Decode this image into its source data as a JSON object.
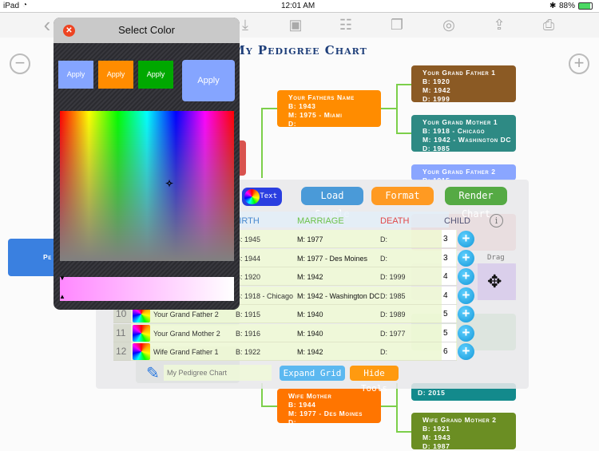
{
  "status": {
    "device": "iPad",
    "time": "12:01 AM",
    "battery": "88%"
  },
  "toolbar": {
    "icons": [
      "back-chevron-icon",
      "download-icon",
      "save-floppy-icon",
      "cabinet-icon",
      "windows-icon",
      "camera-icon",
      "share-icon",
      "printer-icon"
    ]
  },
  "chart": {
    "title": "My Pedigree Chart",
    "boxes": [
      {
        "lines": [
          "Your Grand Father  1",
          "B: 1920",
          "M: 1942",
          "D: 1999"
        ],
        "color": "#8b5a24"
      },
      {
        "lines": [
          "Your Fathers Name",
          "B: 1943",
          "M: 1975 - Miami",
          "D:"
        ],
        "color": "#ff8c00"
      },
      {
        "lines": [
          "Your Grand Mother 1",
          "B: 1918 - Chicago",
          "M: 1942 - Washington DC",
          "D: 1985"
        ],
        "color": "#2e8a84"
      },
      {
        "lines": [
          "Your Grand Father 2",
          "B: 1915"
        ],
        "color": "#8aa6ff"
      },
      {
        "lines": [
          "Pe"
        ],
        "color": "#3a80e0"
      },
      {
        "lines": [
          "D: 2015"
        ],
        "color": "#138a8c"
      },
      {
        "lines": [
          "Wife Mother",
          "B: 1944",
          "M: 1977 - Des Moines",
          "D:"
        ],
        "color": "#ff7500"
      },
      {
        "lines": [
          "Wife Grand Mother 2",
          "B: 1921",
          "M: 1943",
          "D: 1987"
        ],
        "color": "#6b8e23"
      }
    ]
  },
  "tools": {
    "text_button": "Text",
    "load_sample": "Load Sample",
    "format": "Format",
    "render_chart": "Render Chart",
    "headers": {
      "birth": "BIRTH",
      "marriage": "MARRIAGE",
      "death": "DEATH",
      "child": "CHILD"
    },
    "rows": [
      {
        "num": "",
        "name": "",
        "birth": "B: 1945",
        "marriage": "M: 1977",
        "death": "D:",
        "child": "3"
      },
      {
        "num": "",
        "name": "",
        "birth": "B: 1944",
        "marriage": "M: 1977 - Des Moines",
        "death": "D:",
        "child": "3"
      },
      {
        "num": "",
        "name": "",
        "birth": "B: 1920",
        "marriage": "M: 1942",
        "death": "D: 1999",
        "child": "4"
      },
      {
        "num": "",
        "name": "",
        "birth": "B: 1918 - Chicago",
        "marriage": "M: 1942 - Washington DC",
        "death": "D: 1985",
        "child": "4"
      },
      {
        "num": "10",
        "name": "Your Grand Father 2",
        "birth": "B: 1915",
        "marriage": "M: 1940",
        "death": "D: 1989",
        "child": "5"
      },
      {
        "num": "11",
        "name": "Your Grand Mother 2",
        "birth": "B: 1916",
        "marriage": "M: 1940",
        "death": "D: 1977",
        "child": "5"
      },
      {
        "num": "12",
        "name": "Wife  Grand Father 1",
        "birth": "B: 1922",
        "marriage": "M: 1942",
        "death": "D:",
        "child": "6"
      }
    ],
    "drag": "Drag",
    "chart_name_placeholder": "My Pedigree Chart",
    "expand_grid": "Expand Grid",
    "hide_tools": "Hide Tools"
  },
  "color_picker": {
    "title": "Select Color",
    "apply": [
      "Apply",
      "Apply",
      "Apply",
      "Apply"
    ],
    "apply_colors": [
      "#85a5ff",
      "#ff8c00",
      "#00a800",
      "#85a5ff"
    ],
    "selected_color": "#ff88ff"
  }
}
